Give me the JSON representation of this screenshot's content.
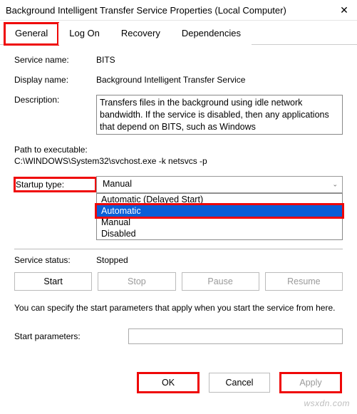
{
  "window": {
    "title": "Background Intelligent Transfer Service Properties (Local Computer)"
  },
  "tabs": {
    "general": "General",
    "logon": "Log On",
    "recovery": "Recovery",
    "dependencies": "Dependencies"
  },
  "labels": {
    "service_name": "Service name:",
    "display_name": "Display name:",
    "description": "Description:",
    "path_to_exe": "Path to executable:",
    "startup_type": "Startup type:",
    "service_status": "Service status:",
    "start_params": "Start parameters:",
    "note": "You can specify the start parameters that apply when you start the service from here."
  },
  "values": {
    "service_name": "BITS",
    "display_name": "Background Intelligent Transfer Service",
    "description": "Transfers files in the background using idle network bandwidth. If the service is disabled, then any applications that depend on BITS, such as Windows",
    "path": "C:\\WINDOWS\\System32\\svchost.exe -k netsvcs -p",
    "startup_selected": "Manual",
    "service_status": "Stopped",
    "start_params": ""
  },
  "dropdown": {
    "options": {
      "delayed": "Automatic (Delayed Start)",
      "automatic": "Automatic",
      "manual": "Manual",
      "disabled": "Disabled"
    }
  },
  "buttons": {
    "start": "Start",
    "stop": "Stop",
    "pause": "Pause",
    "resume": "Resume",
    "ok": "OK",
    "cancel": "Cancel",
    "apply": "Apply"
  },
  "watermark": "wsxdn.com"
}
